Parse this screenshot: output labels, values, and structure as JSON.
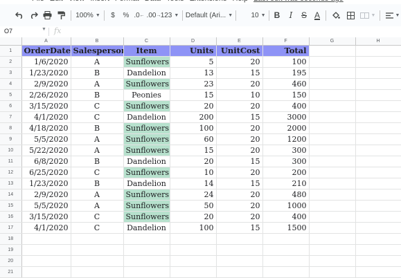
{
  "menu": {
    "items": [
      "File",
      "Edit",
      "View",
      "Insert",
      "Format",
      "Data",
      "Tools",
      "Extensions",
      "Help"
    ],
    "last_edit": "Last edit was seconds ago"
  },
  "toolbar": {
    "zoom": "100%",
    "currency": "$",
    "percent": "%",
    "decrease_decimal": ".0",
    "increase_decimal": ".00",
    "number_format": "123",
    "font": "Default (Ari...",
    "font_size": "10",
    "bold": "B",
    "italic": "I",
    "strike": "S",
    "text_color": "A"
  },
  "formula_bar": {
    "name_box": "O7",
    "fx": "fx"
  },
  "columns": [
    "A",
    "B",
    "C",
    "D",
    "E",
    "F",
    "G",
    "H"
  ],
  "header": [
    "OrderDate",
    "Salesperson",
    "Item",
    "Units",
    "UnitCost",
    "Total"
  ],
  "rows": [
    [
      "1/6/2020",
      "A",
      "Sunflowers",
      "5",
      "20",
      "100"
    ],
    [
      "1/23/2020",
      "B",
      "Dandelion",
      "13",
      "15",
      "195"
    ],
    [
      "2/9/2020",
      "A",
      "Sunflowers",
      "23",
      "20",
      "460"
    ],
    [
      "2/26/2020",
      "B",
      "Peonies",
      "15",
      "10",
      "150"
    ],
    [
      "3/15/2020",
      "C",
      "Sunflowers",
      "20",
      "20",
      "400"
    ],
    [
      "4/1/2020",
      "C",
      "Dandelion",
      "200",
      "15",
      "3000"
    ],
    [
      "4/18/2020",
      "B",
      "Sunflowers",
      "100",
      "20",
      "2000"
    ],
    [
      "5/5/2020",
      "A",
      "Sunflowers",
      "60",
      "20",
      "1200"
    ],
    [
      "5/22/2020",
      "A",
      "Sunflowers",
      "15",
      "20",
      "300"
    ],
    [
      "6/8/2020",
      "B",
      "Dandelion",
      "20",
      "15",
      "300"
    ],
    [
      "6/25/2020",
      "C",
      "Sunflowers",
      "10",
      "20",
      "200"
    ],
    [
      "1/23/2020",
      "B",
      "Dandelion",
      "14",
      "15",
      "210"
    ],
    [
      "2/9/2020",
      "A",
      "Sunflowers",
      "24",
      "20",
      "480"
    ],
    [
      "5/5/2020",
      "A",
      "Sunflowers",
      "50",
      "20",
      "1000"
    ],
    [
      "3/15/2020",
      "C",
      "Sunflowers",
      "20",
      "20",
      "400"
    ],
    [
      "4/1/2020",
      "C",
      "Dandelion",
      "100",
      "15",
      "1500"
    ]
  ],
  "row_numbers": [
    "1",
    "2",
    "3",
    "4",
    "5",
    "6",
    "7",
    "8",
    "9",
    "10",
    "11",
    "12",
    "13",
    "14",
    "15",
    "16",
    "17",
    "18",
    "19",
    "20",
    "21"
  ],
  "colors": {
    "header_fill": "#8e93f6",
    "sunflowers_fill": "#b7e1cd"
  }
}
